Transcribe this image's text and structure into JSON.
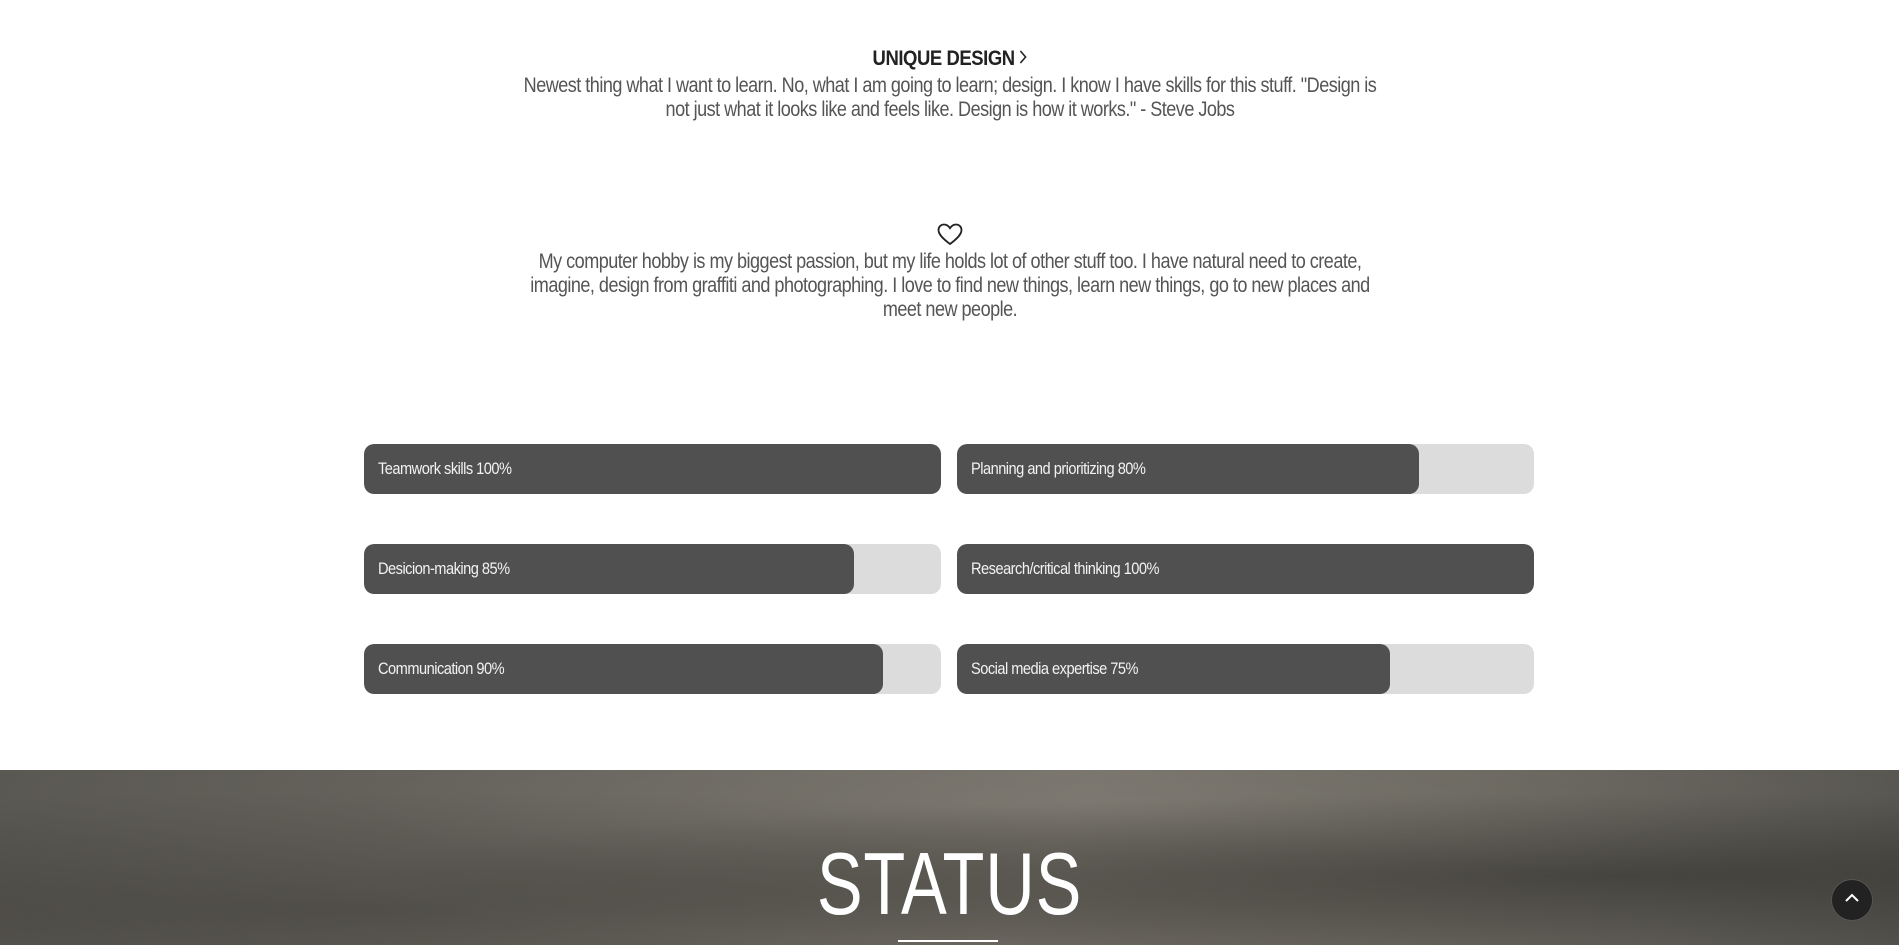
{
  "features": [
    {
      "title": "UNIQUE DESIGN",
      "icon": "chevron-right-icon",
      "text": "Newest thing what I want to learn. No, what I am going to learn; design. I know I have skills for this stuff. \"Design is not just what it looks like and feels like. Design is how it works.\" - Steve Jobs"
    },
    {
      "icon": "heart-icon",
      "text": "My computer hobby is my biggest passion, but my life holds lot of other stuff too. I have natural need to create, imagine, design from graffiti and photographing. I love to find new things, learn new things, go to new places and meet new people."
    }
  ],
  "skills": [
    {
      "label": "Teamwork skills 100%",
      "percent": 100
    },
    {
      "label": "Planning and prioritizing 80%",
      "percent": 80
    },
    {
      "label": "Desicion-making 85%",
      "percent": 85
    },
    {
      "label": "Research/critical thinking 100%",
      "percent": 100
    },
    {
      "label": "Communication 90%",
      "percent": 90
    },
    {
      "label": "Social media expertise 75%",
      "percent": 75
    }
  ],
  "status": {
    "title": "STATUS"
  },
  "back_to_top": {
    "icon": "chevron-up-icon"
  },
  "colors": {
    "bar_fill": "#505050",
    "bar_track": "#dcdcdc",
    "status_bg": "#6a675f"
  }
}
